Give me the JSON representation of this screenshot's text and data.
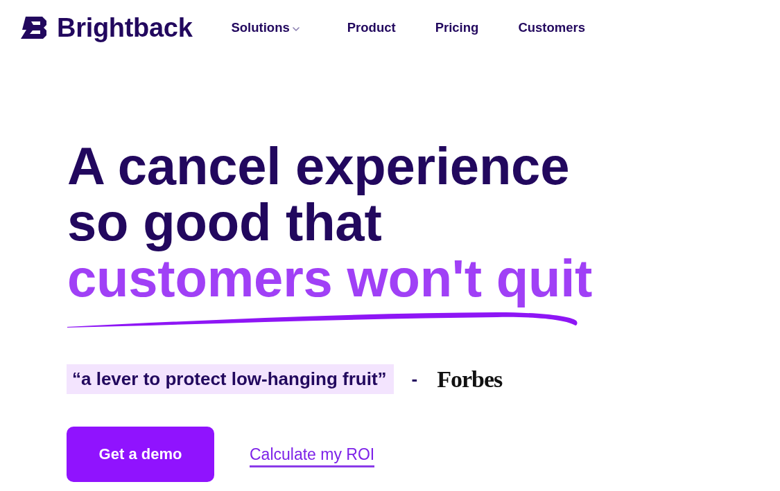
{
  "header": {
    "logo": {
      "text": "Brightback"
    },
    "nav": [
      {
        "label": "Solutions",
        "dropdown": true
      },
      {
        "label": "Product",
        "dropdown": false
      },
      {
        "label": "Pricing",
        "dropdown": false
      },
      {
        "label": "Customers",
        "dropdown": false
      }
    ]
  },
  "hero": {
    "headline": [
      {
        "text": "A cancel experience",
        "kind": "plain"
      },
      {
        "text": "so good that",
        "kind": "plain"
      },
      {
        "text": "customers won't quit",
        "kind": "accent"
      }
    ],
    "quote": {
      "text": "“a lever to protect low-hanging fruit”",
      "separator": "-",
      "source": "Forbes"
    },
    "actions": [
      {
        "label": "Get a demo",
        "kind": "button"
      },
      {
        "label": "Calculate my ROI",
        "kind": "link"
      }
    ]
  }
}
